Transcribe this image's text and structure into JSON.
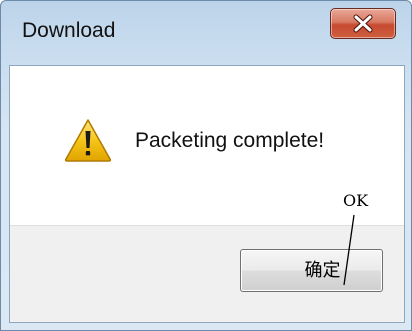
{
  "window": {
    "title": "Download"
  },
  "dialog": {
    "message": "Packeting complete!",
    "icon": "warning-icon"
  },
  "buttons": {
    "ok_label": "确定"
  },
  "annotation": {
    "text": "OK"
  },
  "colors": {
    "title_bar": "#c8dcef",
    "close_button": "#c64a30",
    "warning_yellow": "#f5c518",
    "button_area": "#f0f0f0"
  }
}
